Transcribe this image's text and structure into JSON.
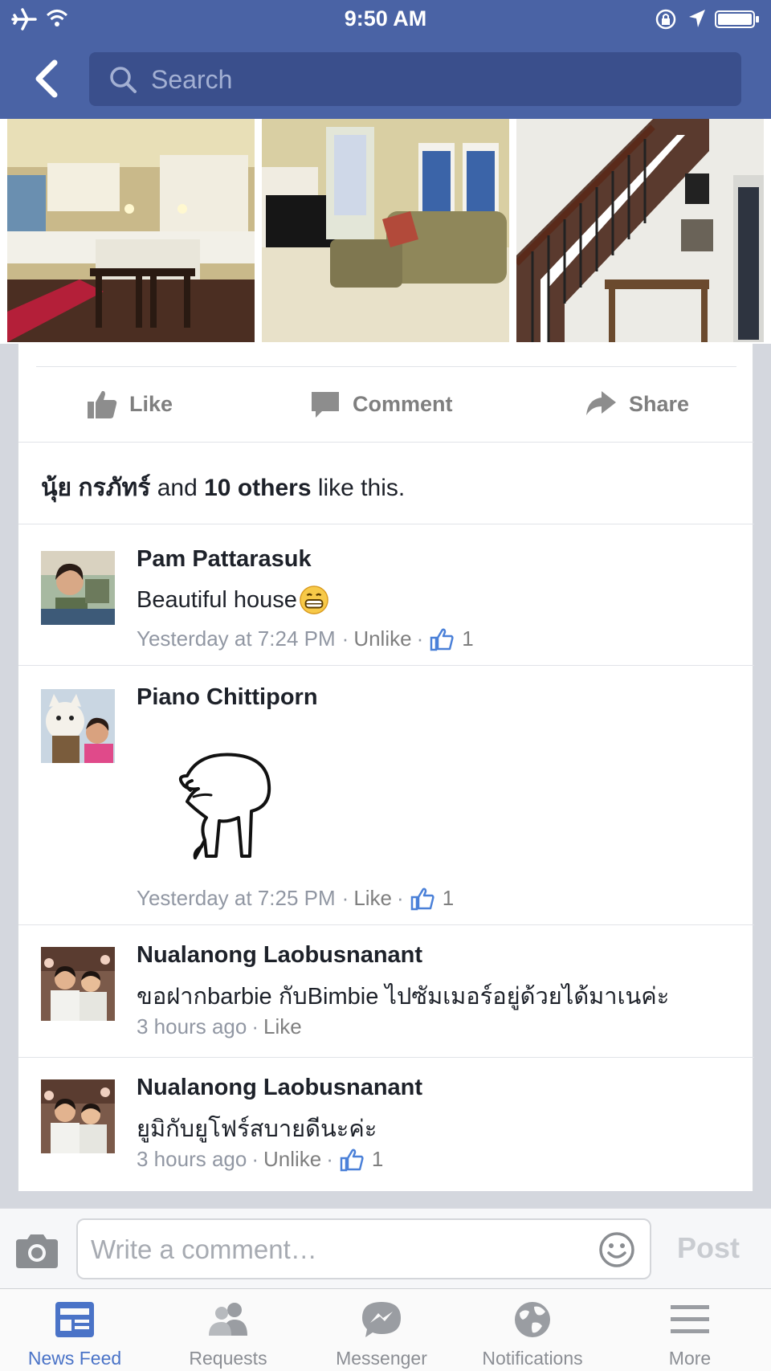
{
  "status_bar": {
    "time": "9:50 AM",
    "icons": [
      "airplane-icon",
      "wifi-icon",
      "rotation-lock-icon",
      "location-arrow-icon",
      "battery-icon"
    ]
  },
  "header": {
    "back_icon": "chevron-left-icon",
    "search_placeholder": "Search"
  },
  "photos": [
    "kitchen",
    "living-room",
    "staircase"
  ],
  "actions": {
    "like": "Like",
    "comment": "Comment",
    "share": "Share"
  },
  "likes_summary": {
    "name": "นุ้ย กรภัทร์",
    "middle": " and ",
    "others": "10 others",
    "suffix": " like this."
  },
  "comments": [
    {
      "author": "Pam Pattarasuk",
      "text": "Beautiful house",
      "emoji": "grinning-face-icon",
      "time": "Yesterday at 7:24 PM",
      "action": "Unlike",
      "likes": "1"
    },
    {
      "author": "Piano Chittiporn",
      "sticker": "cartoon-sticker",
      "time": "Yesterday at 7:25 PM",
      "action": "Like",
      "likes": "1"
    },
    {
      "author": "Nualanong Laobusnanant",
      "text": "ขอฝากbarbie กับBimbie ไปซัมเมอร์อยู่ด้วยได้มาเนค่ะ",
      "time": "3 hours ago",
      "action": "Like"
    },
    {
      "author": "Nualanong Laobusnanant",
      "text": "ยูมิกับยูโฟร์สบายดีนะค่ะ",
      "time": "3 hours ago",
      "action": "Unlike",
      "likes": "1"
    }
  ],
  "composer": {
    "placeholder": "Write a comment…",
    "post_label": "Post"
  },
  "tabs": [
    {
      "label": "News Feed",
      "icon": "news-feed-icon",
      "active": true
    },
    {
      "label": "Requests",
      "icon": "friends-icon",
      "active": false
    },
    {
      "label": "Messenger",
      "icon": "messenger-icon",
      "active": false
    },
    {
      "label": "Notifications",
      "icon": "globe-icon",
      "active": false
    },
    {
      "label": "More",
      "icon": "menu-icon",
      "active": false
    }
  ],
  "colors": {
    "brand": "#4a63a5",
    "search_bg": "#3a4f8c",
    "active_tab": "#4a73c7",
    "like_blue": "#4a80d8"
  }
}
